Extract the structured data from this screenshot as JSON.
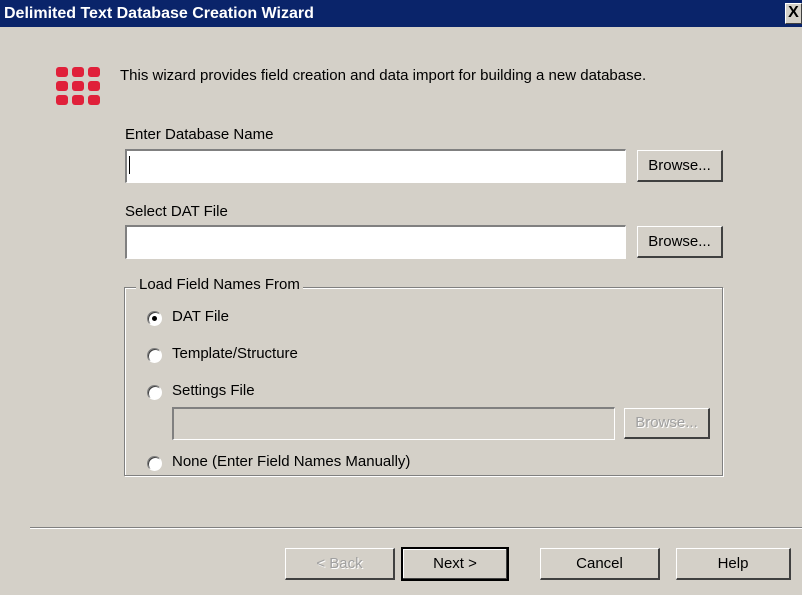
{
  "window": {
    "title": "Delimited Text Database Creation Wizard",
    "close_label": "X"
  },
  "intro_text": "This wizard provides field creation and data import for building a new database.",
  "database_name": {
    "label": "Enter Database Name",
    "value": "",
    "browse_label": "Browse..."
  },
  "dat_file": {
    "label": "Select DAT File",
    "value": "",
    "browse_label": "Browse..."
  },
  "load_field_names": {
    "legend": "Load Field Names From",
    "options": [
      {
        "label": "DAT File",
        "selected": true
      },
      {
        "label": "Template/Structure",
        "selected": false
      },
      {
        "label": "Settings File",
        "selected": false
      },
      {
        "label": "None (Enter Field Names Manually)",
        "selected": false
      }
    ],
    "settings_file_value": "",
    "settings_browse_label": "Browse..."
  },
  "footer": {
    "back_label": "< Back",
    "next_label": "Next >",
    "cancel_label": "Cancel",
    "help_label": "Help"
  },
  "icon": {
    "name": "grid-icon",
    "color": "#e0203a"
  }
}
